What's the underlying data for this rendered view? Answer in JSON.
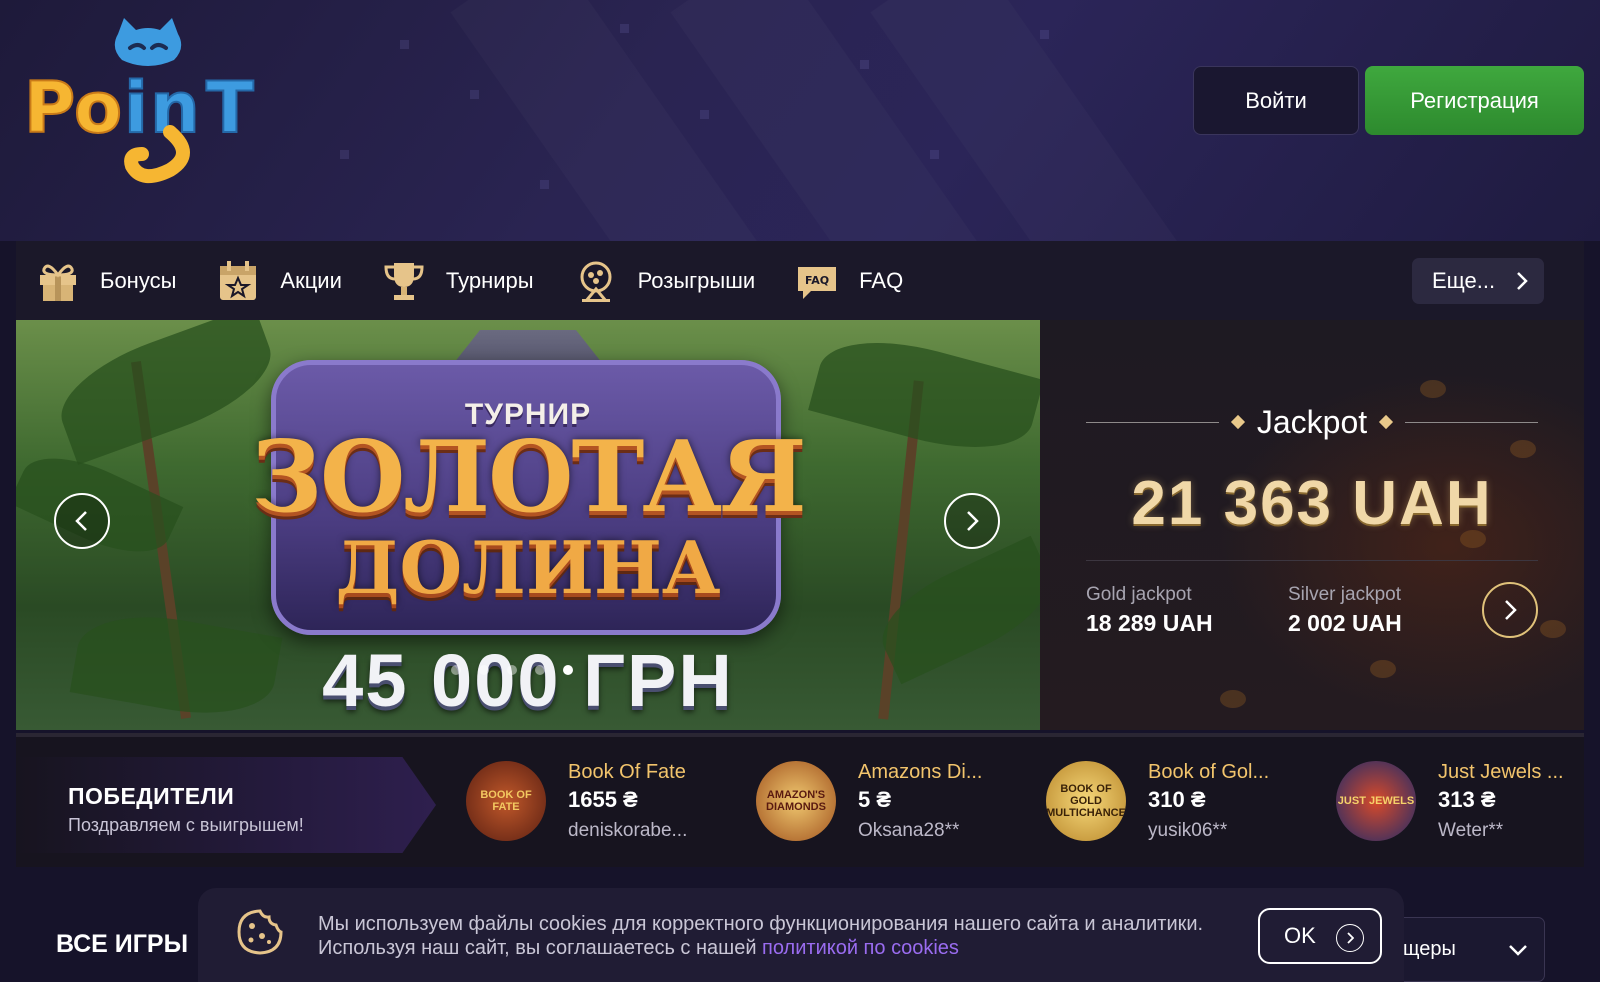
{
  "header": {
    "logo_text": "POINT",
    "login_label": "Войти",
    "register_label": "Регистрация",
    "colors": {
      "register_bg": "#3fa83e",
      "logo_yellow": "#f6b632",
      "logo_blue": "#3d9be0"
    }
  },
  "nav": {
    "items": [
      {
        "label": "Бонусы",
        "icon": "gift-icon"
      },
      {
        "label": "Акции",
        "icon": "calendar-star-icon"
      },
      {
        "label": "Турниры",
        "icon": "trophy-icon"
      },
      {
        "label": "Розыгрыши",
        "icon": "lottery-drum-icon"
      },
      {
        "label": "FAQ",
        "icon": "faq-icon",
        "icon_text": "FAQ"
      }
    ],
    "more_label": "Еще..."
  },
  "banner": {
    "tag": "ТУРНИР",
    "title_line1": "ЗОЛОТАЯ",
    "title_line2": "ДОЛИНА",
    "prize": "45 000 ГРН",
    "slide_count": 5,
    "active_slide": 4
  },
  "jackpot": {
    "title": "Jackpot",
    "amount": "21 363 UAH",
    "gold_label": "Gold jackpot",
    "gold_value": "18 289 UAH",
    "silver_label": "Silver jackpot",
    "silver_value": "2 002 UAH"
  },
  "winners": {
    "title": "ПОБЕДИТЕЛИ",
    "subtitle": "Поздравляем с выигрышем!",
    "items": [
      {
        "game": "Book Of Fate",
        "amount": "1655 ₴",
        "user": "deniskorabe...",
        "thumb_text": "BOOK OF FATE"
      },
      {
        "game": "Amazons Di...",
        "amount": "5 ₴",
        "user": "Oksana28**",
        "thumb_text": "AMAZON'S DIAMONDS"
      },
      {
        "game": "Book of Gol...",
        "amount": "310 ₴",
        "user": "yusik06**",
        "thumb_text": "BOOK OF GOLD MULTICHANCE"
      },
      {
        "game": "Just Jewels ...",
        "amount": "313 ₴",
        "user": "Weter**",
        "thumb_text": "JUST JEWELS"
      }
    ]
  },
  "games": {
    "section_title": "ВСЕ ИГРЫ",
    "providers_label": "щеры"
  },
  "cookie": {
    "line1": "Мы используем файлы cookies для корректного функционирования нашего сайта и аналитики.",
    "line2": "Используя наш сайт, вы соглашаетесь с нашей ",
    "link": "политикой по cookies",
    "ok_label": "OK"
  }
}
